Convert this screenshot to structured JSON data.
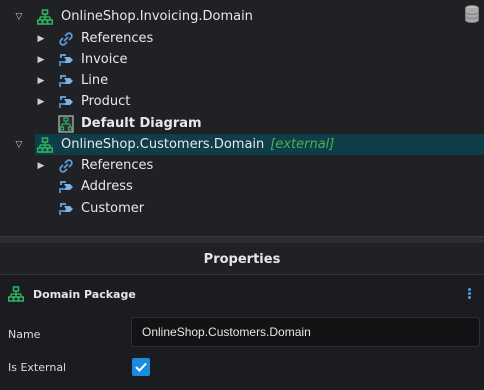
{
  "tree": {
    "items": [
      {
        "label": "OnlineShop.Invoicing.Domain",
        "icon": "package-icon",
        "expander": "expanded"
      },
      {
        "label": "References",
        "icon": "link-icon",
        "expander": "collapsed"
      },
      {
        "label": "Invoice",
        "icon": "class-icon",
        "expander": "collapsed"
      },
      {
        "label": "Line",
        "icon": "class-icon",
        "expander": "collapsed"
      },
      {
        "label": "Product",
        "icon": "class-icon",
        "expander": "collapsed"
      },
      {
        "label": "Default Diagram",
        "icon": "diagram-icon",
        "expander": "none"
      },
      {
        "label": "OnlineShop.Customers.Domain",
        "suffix": "[external]",
        "icon": "package-icon",
        "expander": "expanded",
        "selected": true
      },
      {
        "label": "References",
        "icon": "link-icon",
        "expander": "collapsed"
      },
      {
        "label": "Address",
        "icon": "class-icon",
        "expander": "none"
      },
      {
        "label": "Customer",
        "icon": "class-icon",
        "expander": "none"
      }
    ]
  },
  "properties": {
    "title": "Properties",
    "element_type": "Domain Package",
    "name_label": "Name",
    "name_value": "OnlineShop.Customers.Domain",
    "is_external_label": "Is External",
    "is_external_checked": true
  },
  "colors": {
    "package_icon": "#2fae5e",
    "class_icon": "#5b9bd5",
    "selection": "#0f3d4a",
    "external_text": "#4caf50",
    "checkbox": "#1a8ce0"
  }
}
